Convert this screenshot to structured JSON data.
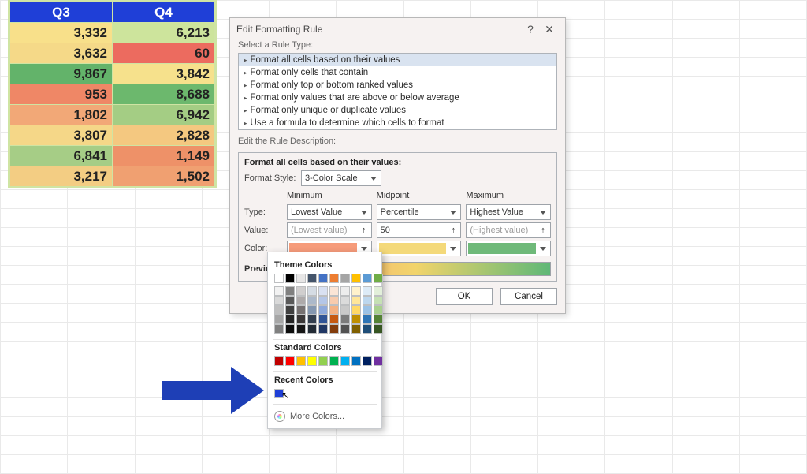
{
  "table": {
    "headers": [
      "Q3",
      "Q4"
    ],
    "rows": [
      {
        "q3": "3,332",
        "q3c": "#f8e08a",
        "q4": "6,213",
        "q4c": "#cde49c"
      },
      {
        "q3": "3,632",
        "q3c": "#f5d988",
        "q4": "60",
        "q4c": "#ec6b5f"
      },
      {
        "q3": "9,867",
        "q3c": "#63b36a",
        "q4": "3,842",
        "q4c": "#f6e18c"
      },
      {
        "q3": "953",
        "q3c": "#ef8766",
        "q4": "8,688",
        "q4c": "#6cb86d"
      },
      {
        "q3": "1,802",
        "q3c": "#f2a877",
        "q4": "6,942",
        "q4c": "#a4cd84"
      },
      {
        "q3": "3,807",
        "q3c": "#f5d788",
        "q4": "2,828",
        "q4c": "#f4c880"
      },
      {
        "q3": "6,841",
        "q3c": "#a6cd86",
        "q4": "1,149",
        "q4c": "#ee9168"
      },
      {
        "q3": "3,217",
        "q3c": "#f3cd83",
        "q4": "1,502",
        "q4c": "#f0a071"
      }
    ]
  },
  "dialog": {
    "title": "Edit Formatting Rule",
    "help": "?",
    "close": "✕",
    "select_label": "Select a Rule Type:",
    "rules": [
      "Format all cells based on their values",
      "Format only cells that contain",
      "Format only top or bottom ranked values",
      "Format only values that are above or below average",
      "Format only unique or duplicate values",
      "Use a formula to determine which cells to format"
    ],
    "edit_label": "Edit the Rule Description:",
    "desc_header": "Format all cells based on their values:",
    "format_style_label": "Format Style:",
    "format_style_value": "3-Color Scale",
    "col_labels": [
      "Minimum",
      "Midpoint",
      "Maximum"
    ],
    "row_type_label": "Type:",
    "type_values": [
      "Lowest Value",
      "Percentile",
      "Highest Value"
    ],
    "row_value_label": "Value:",
    "value_values": [
      "(Lowest value)",
      "50",
      "(Highest value)"
    ],
    "row_color_label": "Color:",
    "color_values": [
      "#f69b7a",
      "#f4d97a",
      "#6fb979"
    ],
    "preview_label": "Preview",
    "ok": "OK",
    "cancel": "Cancel"
  },
  "picker": {
    "theme_label": "Theme Colors",
    "standard_label": "Standard Colors",
    "recent_label": "Recent Colors",
    "more_label": "More Colors...",
    "theme_row": [
      "#ffffff",
      "#000000",
      "#e7e6e6",
      "#44546a",
      "#4472c4",
      "#ed7d31",
      "#a5a5a5",
      "#ffc000",
      "#5b9bd5",
      "#70ad47"
    ],
    "theme_tints": [
      [
        "#f2f2f2",
        "#808080",
        "#d0cece",
        "#d5dce4",
        "#d9e1f2",
        "#fbe5d6",
        "#ededed",
        "#fff2cc",
        "#ddebf7",
        "#e2efda"
      ],
      [
        "#d9d9d9",
        "#595959",
        "#aeaaaa",
        "#acb9ca",
        "#b4c6e7",
        "#f8cbad",
        "#dbdbdb",
        "#ffe699",
        "#bdd7ee",
        "#c5e0b4"
      ],
      [
        "#bfbfbf",
        "#404040",
        "#767171",
        "#8497b0",
        "#8ea9db",
        "#f4b183",
        "#c9c9c9",
        "#ffd966",
        "#9bc2e6",
        "#a9d08e"
      ],
      [
        "#a6a6a6",
        "#262626",
        "#3b3838",
        "#333f4f",
        "#305496",
        "#c65911",
        "#7b7b7b",
        "#bf8f00",
        "#2e75b6",
        "#548235"
      ],
      [
        "#808080",
        "#0d0d0d",
        "#161616",
        "#222b35",
        "#203764",
        "#833c0c",
        "#525252",
        "#806000",
        "#1f4e78",
        "#375623"
      ]
    ],
    "standard": [
      "#c00000",
      "#ff0000",
      "#ffc000",
      "#ffff00",
      "#92d050",
      "#00b050",
      "#00b0f0",
      "#0070c0",
      "#002060",
      "#7030a0"
    ],
    "recent": [
      "#1f3fd7"
    ]
  }
}
